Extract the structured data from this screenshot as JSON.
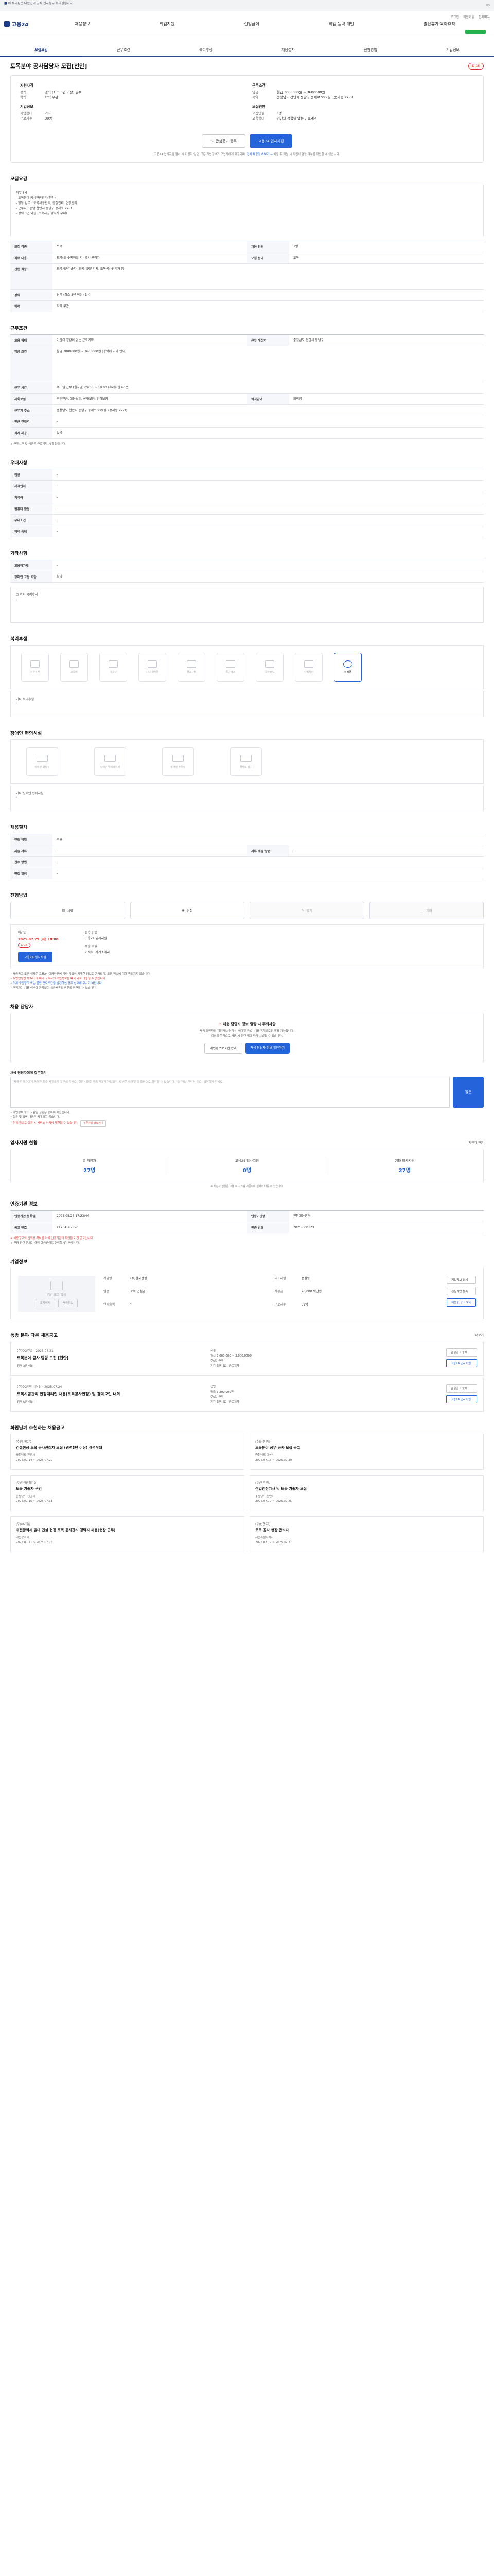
{
  "gov": {
    "notice": "이 누리집은 대한민국 공식 전자정부 누리집입니다.",
    "hd": "HD"
  },
  "topbar": {
    "logo": "고용24",
    "nav": [
      "채용정보",
      "취업지원",
      "실업급여",
      "직업 능력 개발",
      "출산휴가·육아휴직"
    ],
    "utility": [
      "로그인",
      "회원가입",
      "전체메뉴"
    ]
  },
  "tabs": [
    {
      "label": "모집요강",
      "on": true
    },
    {
      "label": "근무조건",
      "on": false
    },
    {
      "label": "복리후생",
      "on": false
    },
    {
      "label": "채용절차",
      "on": false
    },
    {
      "label": "전형방법",
      "on": false
    },
    {
      "label": "기업정보",
      "on": false
    }
  ],
  "job": {
    "title": "토목분야 공사담당자 모집[천안]",
    "dday": "D-16",
    "summary_left": {
      "heading": "지원자격",
      "rows": [
        {
          "k": "경력",
          "v": "경력 (최소 3년 이상) 필수"
        },
        {
          "k": "학력",
          "v": "학력 무관"
        }
      ]
    },
    "summary_right": {
      "heading": "근무조건",
      "rows": [
        {
          "k": "임금",
          "v": "월급 3000000원 ~ 3600000원"
        },
        {
          "k": "지역",
          "v": "충청남도 천안시 동남구 풍세로 999길, (풍세동 27-3)"
        }
      ]
    },
    "summary_left2": {
      "heading": "기업정보",
      "rows": [
        {
          "k": "기업형태",
          "v": "기타"
        },
        {
          "k": "근로자수",
          "v": "39명"
        }
      ]
    },
    "summary_right2": {
      "heading": "모집인원",
      "rows": [
        {
          "k": "모집인원",
          "v": "1명"
        },
        {
          "k": "고용형태",
          "v": "기간의 정함이 없는 근로계약"
        }
      ]
    },
    "btn_scrap": "관심공고 등록",
    "btn_apply": "고용24 입사지원",
    "note": "고용24 입사지원 절차 시 지원자 임금, 모든 개인정보가 구인자에게 제공되며,",
    "note_link": "전체 채용정보 보기 →",
    "note_tail": "채용 후 지원 시 지원서 열람 여부를 확인할 수 있습니다."
  },
  "recruit": {
    "heading": "모집요강",
    "body": [
      "직무내용",
      "- 토목분야 공사현장관리(천안)",
      "- 담당 업무 : 토목시공관리, 공정관리, 현장관리",
      "- 근무지 : 충남 천안시 동남구 풍세로 27-3",
      "- 경력 3년 이상 (토목시공 경력자 우대)"
    ],
    "rows": [
      {
        "k": "모집 직종",
        "v": "토목"
      },
      {
        "k": "직무 내용",
        "v": "토목(도시·지하철 외) 공사 관리자"
      },
      {
        "k": "관련 직종",
        "v": "토목시공기술자, 토목시공관리자, 토목공사관리자 등"
      },
      {
        "k": "경력",
        "v": "경력 (최소 3년 이상) 필수"
      },
      {
        "k": "학력",
        "v": "학력 무관"
      }
    ],
    "rows_right": [
      {
        "k": "채용 인원",
        "v": "1명"
      },
      {
        "k": "모집 분야",
        "v": "토목"
      }
    ]
  },
  "conditions": {
    "heading": "근무조건",
    "rows": [
      {
        "k": "고용 형태",
        "v": "기간의 정함이 없는 근로계약",
        "k2": "근무 예정지",
        "v2": "충청남도 천안시 동남구"
      },
      {
        "k": "임금 조건",
        "v": "월급 3000000원 ~ 3600000원 (경력에 따라 협의)"
      },
      {
        "k": "근무 시간",
        "v": "주 5일 근무 (월~금) 09:00 ~ 18:00 (휴게시간 60분)"
      },
      {
        "k": "사회보험",
        "v": "국민연금, 고용보험, 산재보험, 건강보험",
        "k2": "퇴직급여",
        "v2": "퇴직금"
      },
      {
        "k": "근무지 주소",
        "v": "충청남도 천안시 동남구 풍세로 999길, (풍세동 27-3)"
      },
      {
        "k": "인근 전철역",
        "v": "-"
      },
      {
        "k": "식사 제공",
        "v": "없음"
      }
    ],
    "note": "※ 근무시간 및 임금은 근로계약 시 확정됩니다."
  },
  "qualify": {
    "heading": "우대사항",
    "rows": [
      {
        "k": "전공",
        "v": "-"
      },
      {
        "k": "자격면허",
        "v": "-"
      },
      {
        "k": "외국어",
        "v": "-"
      },
      {
        "k": "컴퓨터 활용",
        "v": "-"
      },
      {
        "k": "우대조건",
        "v": "-"
      },
      {
        "k": "병역 특례",
        "v": "-"
      }
    ]
  },
  "etc": {
    "heading": "기타사항",
    "rows": [
      {
        "k": "고용허가제",
        "v": "-"
      },
      {
        "k": "장애인 고용 희망",
        "v": "희망"
      }
    ],
    "extra": "그 밖의 복리후생",
    "extra_val": "-"
  },
  "welfare": {
    "heading": "복리후생",
    "items": [
      {
        "label": "건강검진",
        "on": false
      },
      {
        "label": "교육비",
        "on": false
      },
      {
        "label": "기숙사",
        "on": false
      },
      {
        "label": "자녀 학자금",
        "on": false
      },
      {
        "label": "경조사비",
        "on": false
      },
      {
        "label": "통근버스",
        "on": false
      },
      {
        "label": "육아휴직",
        "on": false
      },
      {
        "label": "식비지원",
        "on": false
      },
      {
        "label": "퇴직금",
        "on": true
      }
    ],
    "note_label": "기타 복리후생",
    "note_val": "-"
  },
  "disabled": {
    "heading": "장애인 편의시설",
    "items": [
      "장애인 화장실",
      "장애인 엘리베이터",
      "장애인 주차장",
      "경사로 설치"
    ],
    "note": "기타 장애인 편의시설",
    "note_val": "-"
  },
  "process": {
    "heading": "채용절차",
    "rows": [
      {
        "k": "전형 방법",
        "v": "서류",
        "k2": "",
        "v2": ""
      },
      {
        "k": "제출 서류",
        "v": "-",
        "k2": "서류 제출 방법",
        "v2": "-"
      },
      {
        "k": "접수 방법",
        "v": "-",
        "k2": "",
        "v2": ""
      },
      {
        "k": "면접 일정",
        "v": "-",
        "k2": "",
        "v2": ""
      }
    ]
  },
  "method": {
    "heading": "전형방법",
    "items": [
      {
        "label": "서류",
        "on": true
      },
      {
        "label": "면접",
        "on": true
      },
      {
        "label": "필기",
        "on": false
      },
      {
        "label": "기타",
        "on": false
      }
    ]
  },
  "apply": {
    "heading": "접수 방법",
    "deadline_label": "마감일",
    "deadline": "2025.07.29 (화) 18:00",
    "dday": "D-16",
    "btn": "고용24 입사지원",
    "way_label": "접수 방법",
    "way": "고용24 입사지원",
    "doc_label": "제출 서류",
    "doc": "이력서, 자기소개서"
  },
  "bullets": [
    {
      "t": "채용공고 모든 내용은 고용24 이용약관에 따라 기업이 게재한 정보로 운영되며, 모든 정보에 대해 책임지지 않습니다.",
      "c": ""
    },
    {
      "t": "직업안정법 제34조에 따라 구직자의 개인정보를 목적 외로 이용할 수 없습니다.",
      "c": "r"
    },
    {
      "t": "허위 구인광고 또는 불법 근로조건을 발견하신 경우 신고해 주시기 바랍니다.",
      "c": "b"
    },
    {
      "t": "구직자는 채용 여부에 관계없이 채용서류의 반환을 청구할 수 있습니다.",
      "c": ""
    }
  ],
  "contact": {
    "heading": "채용 담당자",
    "warn": "채용 담당자 정보 열람 시 주의사항",
    "text": "채용 담당자의 개인정보(연락처, 이메일 등)는 채용 목적으로만 활용 가능합니다.",
    "text2": "이외의 목적으로 사용 시 관련 법에 따라 처벌될 수 있습니다.",
    "b1": "개인정보보호법 안내",
    "b2": "채용 담당자 정보 확인하기"
  },
  "inquiry": {
    "heading": "채용 담당자에게 질문하기",
    "placeholder": "채용 담당자에게 궁금한 점을 자유롭게 질문해 주세요. 질문 내용은 담당자에게 전달되며, 답변은 이메일 및 알림으로 확인할 수 있습니다. 개인정보(연락처 등)는 입력하지 마세요.",
    "btn": "질문",
    "notes": [
      "개인정보 등이 포함된 질문은 등록이 제한됩니다.",
      "질문 및 답변 내용은 공개되지 않습니다.",
      "허위 정보로 질문 시 서비스 이용이 제한될 수 있습니다."
    ],
    "notes_btn": "질문관리 바로가기"
  },
  "stats": {
    "heading": "입사지원 현황",
    "right": "지원자 현황",
    "items": [
      {
        "l": "총 지원자",
        "n": "27명"
      },
      {
        "l": "고용24 입사지원",
        "n": "0명"
      },
      {
        "l": "기타 입사지원",
        "n": "27명"
      }
    ],
    "note": "※ 지원자 현황은 고용24 시스템 기준이며 실제와 다를 수 있습니다."
  },
  "info": {
    "heading": "인증기관 정보",
    "rows": [
      {
        "k": "인증기관 등록일",
        "v": "2025.05.27 17:23:44",
        "k2": "인증기관명",
        "v2": "천안고용센터"
      },
      {
        "k": "공고 번호",
        "v": "K1234567890",
        "k2": "인증 번호",
        "v2": "2025-000123"
      }
    ],
    "note": "※ 채용공고의 신뢰성 확보를 위해 인증기관의 확인을 거친 공고입니다.",
    "note2": "※ 인증 관련 문의는 해당 고용센터로 연락하시기 바랍니다."
  },
  "company": {
    "heading": "기업정보",
    "logo_text": "기업 로고 없음",
    "rows": [
      {
        "k": "기업명",
        "v": "(주)한국건설"
      },
      {
        "k": "대표자명",
        "v": "홍길동"
      },
      {
        "k": "업종",
        "v": "토목 건설업"
      },
      {
        "k": "자본금",
        "v": "20,000 백만원"
      },
      {
        "k": "연매출액",
        "v": "-"
      },
      {
        "k": "근로자수",
        "v": "39명"
      }
    ],
    "btns": [
      "기업정보 상세",
      "관심기업 등록",
      "채용중 공고 보기"
    ],
    "icons": [
      "홈페이지",
      "채용정보"
    ]
  },
  "same": {
    "heading": "동종 분야 다른 채용공고",
    "right": "더보기",
    "jobs": [
      {
        "co": "(주)OO건설",
        "date": "2025.07.21",
        "title": "토목분야 공사 담당 모집 [천안]",
        "tag": "경력 3년 이상",
        "info": [
          "서울",
          "월급 3,000,000 ~ 3,600,000원",
          "주5일 근무",
          "기간 정함 없는 근로계약"
        ]
      },
      {
        "co": "(주)OO엔지니어링",
        "date": "2025.07.24",
        "title": "토목시공관리 현장대리인 채용(토목공사현장) 및 경력 2인 내외",
        "tag": "경력 5년 이상",
        "info": [
          "천안",
          "월급 3,200,000원",
          "주5일 근무",
          "기간 정함 없는 근로계약"
        ]
      }
    ]
  },
  "reco": {
    "heading": "회원님께 추천하는 채용공고",
    "cards": [
      {
        "co": "(주)대한토목",
        "title": "건설현장 토목 공사관리자 모집 (경력3년 이상) 경력우대",
        "m1": "충청남도 천안시",
        "m2": "2025.07.14 ~ 2025.07.29"
      },
      {
        "co": "(주)한빛건설",
        "title": "토목분야 공무·공사 모집 공고",
        "m1": "충청남도 아산시",
        "m2": "2025.07.15 ~ 2025.07.30"
      },
      {
        "co": "(주)미래종합건설",
        "title": "토목 기술자 구인",
        "m1": "충청남도 천안시",
        "m2": "2025.07.16 ~ 2025.07.31"
      },
      {
        "co": "(주)푸른산업",
        "title": "산업안전기사 및 토목 기술자 모집",
        "m1": "충청남도 천안시",
        "m2": "2025.07.10 ~ 2025.07.25"
      },
      {
        "co": "(주)OO개발",
        "title": "대전광역시 일대 건설 현장 토목 공사관리 경력자 채용(현장 근무)",
        "m1": "대전광역시",
        "m2": "2025.07.11 ~ 2025.07.26"
      },
      {
        "co": "(주)신한토건",
        "title": "토목 공사 현장 관리자",
        "m1": "세종특별자치시",
        "m2": "2025.07.12 ~ 2025.07.27"
      }
    ]
  }
}
